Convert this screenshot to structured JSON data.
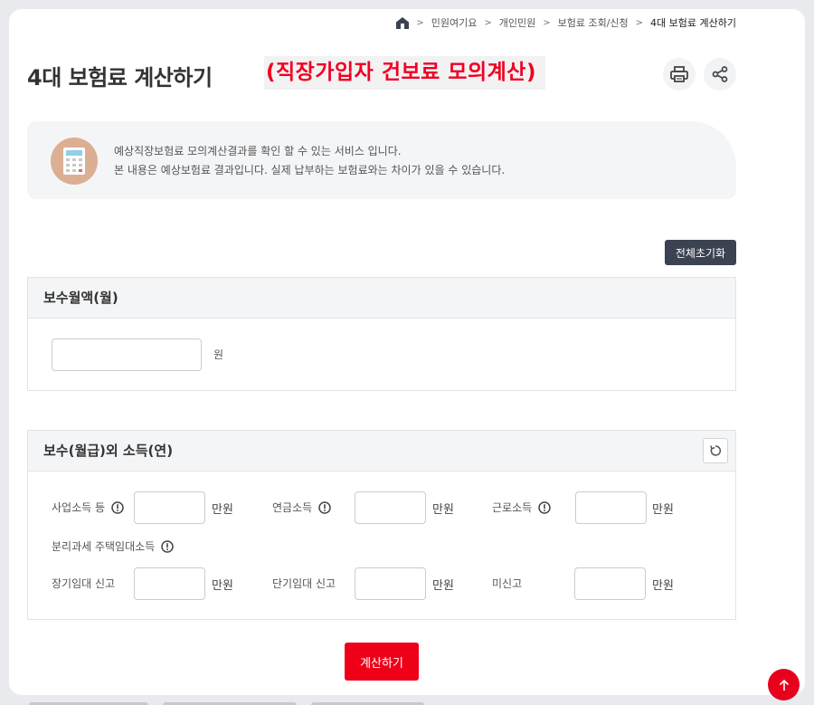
{
  "breadcrumb": [
    "민원여기요",
    "개인민원",
    "보험료 조회/신청",
    "4대 보험료 계산하기"
  ],
  "title": "4대 보험료 계산하기",
  "subtitle": "(직장가입자 건보료 모의계산)",
  "notice": {
    "line1": "예상직장보험료 모의계산결과를 확인 할 수 있는 서비스 입니다.",
    "line2": "본 내용은 예상보험료 결과입니다. 실제 납부하는 보험료와는 차이가 있을 수 있습니다."
  },
  "reset_all_label": "전체초기화",
  "salary_section": {
    "title": "보수월액(월)",
    "input_value": "",
    "unit": "원"
  },
  "other_income_section": {
    "title": "보수(월급)외 소득(연)",
    "business_label": "사업소득 등",
    "pension_label": "연금소득",
    "labor_label": "근로소득",
    "separate_label": "분리과세 주택임대소득",
    "long_term_label": "장기임대 신고",
    "short_term_label": "단기임대 신고",
    "unreported_label": "미신고",
    "unit": "만원"
  },
  "calculate_label": "계산하기",
  "icons": {
    "home": "home-icon",
    "print": "print-icon",
    "share": "share-icon",
    "calculator": "calculator-icon",
    "info": "info-icon",
    "refresh": "refresh-icon",
    "top": "arrow-up-icon"
  },
  "colors": {
    "accent_red": "#ee0019",
    "dark_button": "#3b4252",
    "calculator_circle": "#dcae93"
  }
}
